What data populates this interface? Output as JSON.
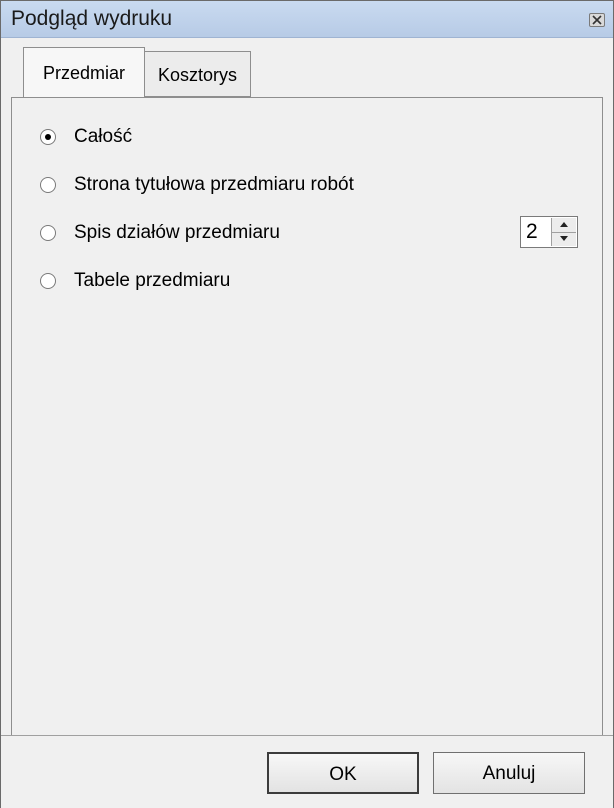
{
  "window": {
    "title": "Podgląd wydruku"
  },
  "tabs": [
    {
      "label": "Przedmiar",
      "selected": true
    },
    {
      "label": "Kosztorys",
      "selected": false
    }
  ],
  "options": [
    {
      "label": "Całość",
      "checked": true
    },
    {
      "label": "Strona tytułowa przedmiaru robót",
      "checked": false
    },
    {
      "label": "Spis działów przedmiaru",
      "checked": false
    },
    {
      "label": "Tabele przedmiaru",
      "checked": false
    }
  ],
  "spinner": {
    "value": "2"
  },
  "buttons": {
    "ok_label": "OK",
    "cancel_label": "Anuluj"
  },
  "icons": {
    "close": "close-icon",
    "spin_up": "arrow-up-icon",
    "spin_down": "arrow-down-icon"
  }
}
